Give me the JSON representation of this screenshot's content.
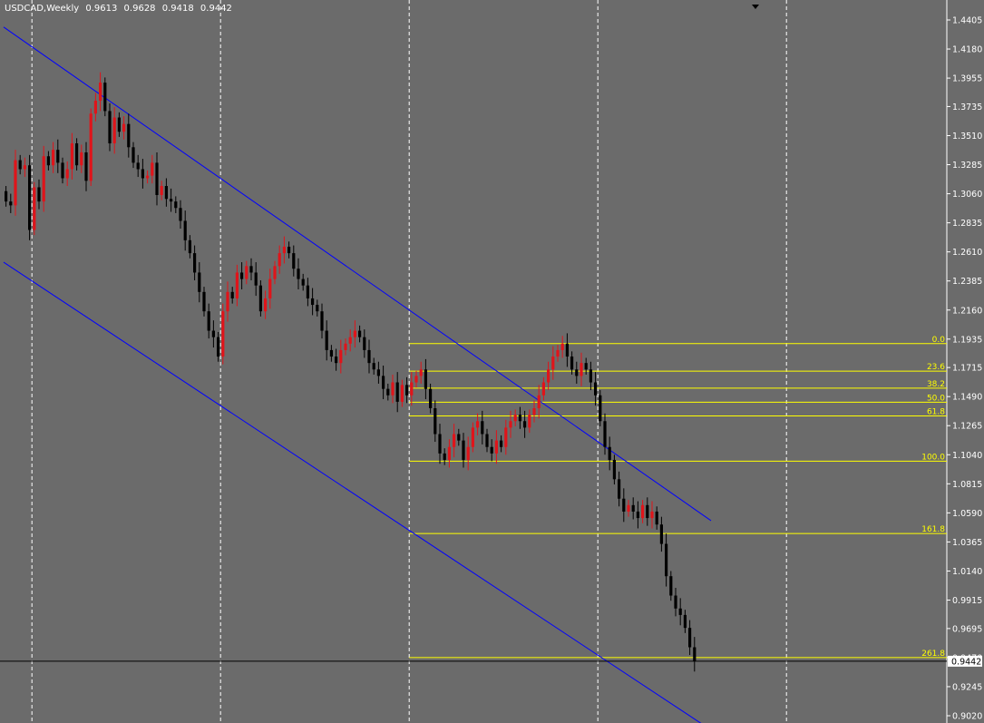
{
  "header": {
    "symbol": "USDCAD,Weekly",
    "open": "0.9613",
    "high": "0.9628",
    "low": "0.9418",
    "close": "0.9442"
  },
  "colors": {
    "background": "#6b6b6b",
    "bull_candle": "#e0141a",
    "bear_candle": "#000000",
    "channel": "#0000ff",
    "fibo": "#ffff00",
    "grid": "#ffffff",
    "price_line": "#000000"
  },
  "chart_data": {
    "type": "candlestick",
    "title": "USDCAD,Weekly",
    "price_axis": {
      "ticks": [
        "1.4405",
        "1.4180",
        "1.3955",
        "1.3735",
        "1.3510",
        "1.3285",
        "1.3060",
        "1.2835",
        "1.2610",
        "1.2385",
        "1.2160",
        "1.1935",
        "1.1715",
        "1.1490",
        "1.1265",
        "1.1040",
        "1.0815",
        "1.0590",
        "1.0365",
        "1.0140",
        "0.9915",
        "0.9695",
        "0.9470",
        "0.9245",
        "0.9020"
      ],
      "range": [
        0.902,
        1.4405
      ]
    },
    "current_price": "0.9442",
    "fibonacci": {
      "levels": [
        {
          "label": "0.0",
          "price": 1.19
        },
        {
          "label": "23.6",
          "price": 1.1687
        },
        {
          "label": "38.2",
          "price": 1.1555
        },
        {
          "label": "50.0",
          "price": 1.1447
        },
        {
          "label": "61.8",
          "price": 1.134
        },
        {
          "label": "100.0",
          "price": 1.099
        },
        {
          "label": "161.8",
          "price": 1.043
        },
        {
          "label": "261.8",
          "price": 0.947
        }
      ]
    },
    "channel": {
      "upper_line": [
        [
          0,
          1.435
        ],
        [
          150,
          1.053
        ]
      ],
      "lower_line": [
        [
          0,
          1.253
        ],
        [
          150,
          0.891
        ]
      ]
    },
    "period_separators": [
      6,
      46,
      86,
      126,
      166
    ],
    "closes": [
      1.3,
      1.297,
      1.332,
      1.325,
      1.328,
      1.278,
      1.311,
      1.3,
      1.335,
      1.328,
      1.34,
      1.33,
      1.318,
      1.325,
      1.345,
      1.328,
      1.338,
      1.316,
      1.368,
      1.378,
      1.392,
      1.37,
      1.345,
      1.365,
      1.354,
      1.36,
      1.342,
      1.33,
      1.325,
      1.318,
      1.32,
      1.33,
      1.305,
      1.312,
      1.302,
      1.3,
      1.295,
      1.285,
      1.27,
      1.26,
      1.245,
      1.23,
      1.215,
      1.2,
      1.195,
      1.18,
      1.215,
      1.23,
      1.225,
      1.245,
      1.24,
      1.25,
      1.245,
      1.235,
      1.215,
      1.225,
      1.24,
      1.25,
      1.26,
      1.265,
      1.26,
      1.248,
      1.24,
      1.235,
      1.225,
      1.22,
      1.215,
      1.2,
      1.185,
      1.18,
      1.175,
      1.185,
      1.19,
      1.195,
      1.2,
      1.195,
      1.185,
      1.175,
      1.17,
      1.165,
      1.155,
      1.15,
      1.16,
      1.145,
      1.158,
      1.15,
      1.16,
      1.165,
      1.17,
      1.155,
      1.14,
      1.12,
      1.105,
      1.1,
      1.11,
      1.12,
      1.115,
      1.1,
      1.11,
      1.125,
      1.13,
      1.12,
      1.11,
      1.105,
      1.115,
      1.11,
      1.125,
      1.13,
      1.135,
      1.13,
      1.125,
      1.135,
      1.14,
      1.15,
      1.16,
      1.17,
      1.18,
      1.185,
      1.19,
      1.18,
      1.17,
      1.165,
      1.175,
      1.17,
      1.16,
      1.15,
      1.13,
      1.11,
      1.1,
      1.085,
      1.07,
      1.06,
      1.065,
      1.06,
      1.055,
      1.065,
      1.055,
      1.06,
      1.05,
      1.035,
      1.01,
      0.995,
      0.985,
      0.98,
      0.97,
      0.955,
      0.9442
    ],
    "volatility_note": ""
  }
}
